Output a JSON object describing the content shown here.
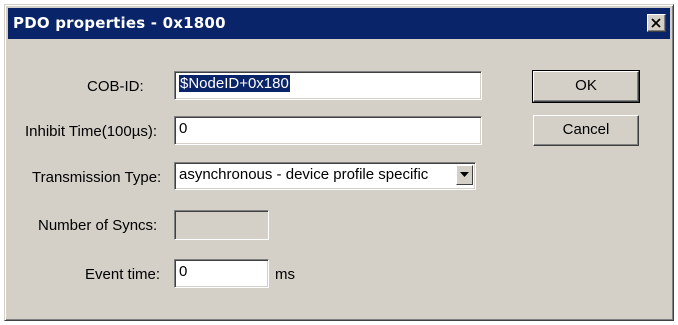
{
  "window": {
    "title": "PDO properties - 0x1800"
  },
  "form": {
    "cob_id": {
      "label": "COB-ID:",
      "value": "$NodeID+0x180"
    },
    "inhibit_time": {
      "label": "Inhibit Time(100µs):",
      "value": "0"
    },
    "transmission_type": {
      "label": "Transmission Type:",
      "value": "asynchronous - device profile specific"
    },
    "number_of_syncs": {
      "label": "Number of Syncs:",
      "value": ""
    },
    "event_time": {
      "label": "Event time:",
      "value": "0",
      "unit": "ms"
    }
  },
  "buttons": {
    "ok_label": "OK",
    "cancel_label": "Cancel"
  },
  "colors": {
    "title_bar": "#0a246a",
    "dialog_face": "#d4d0c8"
  }
}
